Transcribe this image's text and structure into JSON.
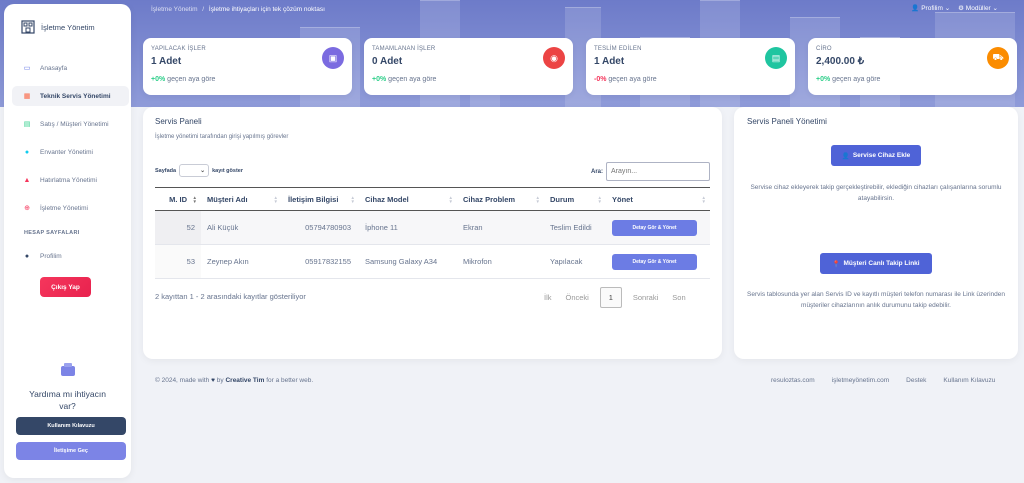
{
  "sidebar": {
    "brand": "İşletme Yönetim",
    "items": [
      {
        "label": "Anasayfa",
        "icon": "monitor-icon"
      },
      {
        "label": "Teknik Servis Yönetimi",
        "icon": "calendar-icon"
      },
      {
        "label": "Satış / Müşteri Yönetimi",
        "icon": "table-icon"
      },
      {
        "label": "Envanter Yönetimi",
        "icon": "circle-icon"
      },
      {
        "label": "Hatırlatma Yönetimi",
        "icon": "bell-icon"
      },
      {
        "label": "İşletme Yönetimi",
        "icon": "globe-icon"
      }
    ],
    "account_section": "HESAP SAYFALARI",
    "profile": "Profilim",
    "logout": "Çıkış Yap",
    "help_title": "Yardıma mı ihtiyacın var?",
    "guide_button": "Kullanım Kılavuzu",
    "contact_button": "İletişime Geç"
  },
  "breadcrumb": {
    "root": "İşletme Yönetim",
    "separator": "/",
    "current": "İşletme ihtiyaçları için tek çözüm noktası"
  },
  "topbar": {
    "profile": "Profilim",
    "modules": "Modüller"
  },
  "stats": [
    {
      "label": "YAPILACAK İŞLER",
      "value": "1 Adet",
      "change": "+0%",
      "change_text": "geçen aya göre",
      "color": "#7b6be0",
      "icon": "clipboard-icon"
    },
    {
      "label": "TAMAMLANAN İŞLER",
      "value": "0 Adet",
      "change": "+0%",
      "change_text": "geçen aya göre",
      "color": "#ec4444",
      "icon": "globe-icon"
    },
    {
      "label": "TESLİM EDİLEN",
      "value": "1 Adet",
      "change": "-0%",
      "change_text": "geçen aya göre",
      "color": "#1fc5a0",
      "icon": "document-icon"
    },
    {
      "label": "CİRO",
      "value": "2,400.00 ₺",
      "change": "+0%",
      "change_text": "geçen aya göre",
      "color": "#fb8c00",
      "icon": "cart-icon"
    }
  ],
  "service_panel": {
    "title": "Servis Paneli",
    "subtitle": "İşletme yönetimi tarafından girişi yapılmış görevler",
    "length_prefix": "Sayfada",
    "length_suffix": "kayıt göster",
    "search_label": "Ara:",
    "search_placeholder": "Arayın...",
    "columns": [
      "M. ID",
      "Müşteri Adı",
      "İletişim Bilgisi",
      "Cihaz Model",
      "Cihaz Problem",
      "Durum",
      "Yönet"
    ],
    "rows": [
      {
        "id": "52",
        "name": "Ali Küçük",
        "phone": "05794780903",
        "model": "İphone 11",
        "problem": "Ekran",
        "status": "Teslim Edildi",
        "action": "Detay Gör & Yönet"
      },
      {
        "id": "53",
        "name": "Zeynep Akın",
        "phone": "05917832155",
        "model": "Samsung Galaxy A34",
        "problem": "Mikrofon",
        "status": "Yapılacak",
        "action": "Detay Gör & Yönet"
      }
    ],
    "info": "2 kayıttan 1 - 2 arasındaki kayıtlar gösteriliyor",
    "pager": {
      "first": "İlk",
      "prev": "Önceki",
      "page": "1",
      "next": "Sonraki",
      "last": "Son"
    }
  },
  "management_panel": {
    "title": "Servis Paneli Yönetimi",
    "add_button": "Servise Cihaz Ekle",
    "add_text": "Servise cihaz ekleyerek takip gerçekleştirebilir, eklediğin cihazları çalışanlarına sorumlu atayabilirsin.",
    "track_button": "Müşteri Canlı Takip Linki",
    "track_text": "Servis tablosunda yer alan Servis ID ve kayıtlı müşteri telefon numarası ile Link üzerinden müşteriler cihazlarının anlık durumunu takip edebilir."
  },
  "footer": {
    "left_prefix": "© 2024, made with",
    "left_by": "by",
    "left_author": "Creative Tim",
    "left_suffix": "for a better web.",
    "links": [
      "resuloztas.com",
      "işletmeyönetim.com",
      "Destek",
      "Kullanım Kılavuzu"
    ]
  }
}
